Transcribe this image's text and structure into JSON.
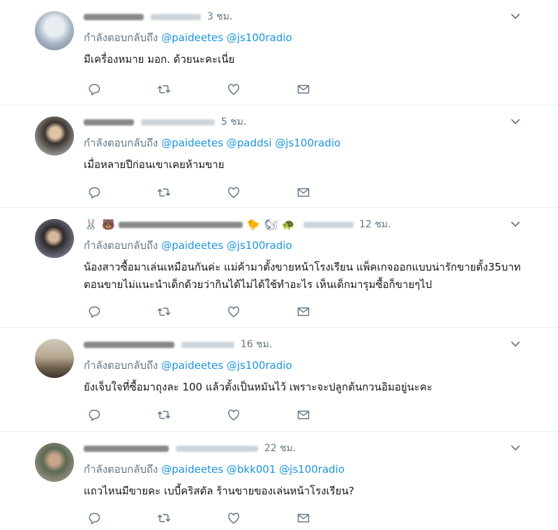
{
  "reply_prefix": "กำลังตอบกลับถึง",
  "colors": {
    "link": "#1b95e0",
    "secondary": "#657786",
    "divider": "#e6ecf0",
    "text": "#14171a"
  },
  "icons": {
    "reply": "reply-icon",
    "retweet": "retweet-icon",
    "like": "heart-icon",
    "dm": "envelope-icon",
    "menu": "chevron-down-icon"
  },
  "tweets": [
    {
      "time": "3 ชม.",
      "mentions": [
        "@paideetes",
        "@js100radio"
      ],
      "text": "มีเครื่องหมาย มอก. ด้วยนะคะเนี่ย"
    },
    {
      "time": "5 ชม.",
      "mentions": [
        "@paideetes",
        "@paddsi",
        "@js100radio"
      ],
      "text": "เมื่อหลายปีก่อนเขาเคยห้ามขาย"
    },
    {
      "time": "12 ชม.",
      "mentions": [
        "@paideetes",
        "@js100radio"
      ],
      "text": "น้องสาวซื้อมาเล่นเหมือนกันค่ะ แม่ค้ามาตั้งขายหน้าโรงเรียน แพ็คเกจออกแบบน่ารักขายตั้ง35บาท ตอนขายไม่แนะนำเด็กด้วยว่ากินได้ไม่ได้ใช้ทำอะไร เห็นเด็กมารุมซื้อก็ขายๆไป"
    },
    {
      "time": "16 ชม.",
      "mentions": [
        "@paideetes",
        "@js100radio"
      ],
      "text": "ยังเจ็บใจที่ซื้อมาถุงละ 100 แล้วตั้งเป็นหมันไว้ เพราะจะปลูกต้นกวนอิมอยู่นะคะ"
    },
    {
      "time": "22 ชม.",
      "mentions": [
        "@paideetes",
        "@bkk001",
        "@js100radio"
      ],
      "text": "แถวไหนมีขายคะ เบบี้คริสตัล ร้านขายของเล่นหน้าโรงเรียน?"
    }
  ]
}
